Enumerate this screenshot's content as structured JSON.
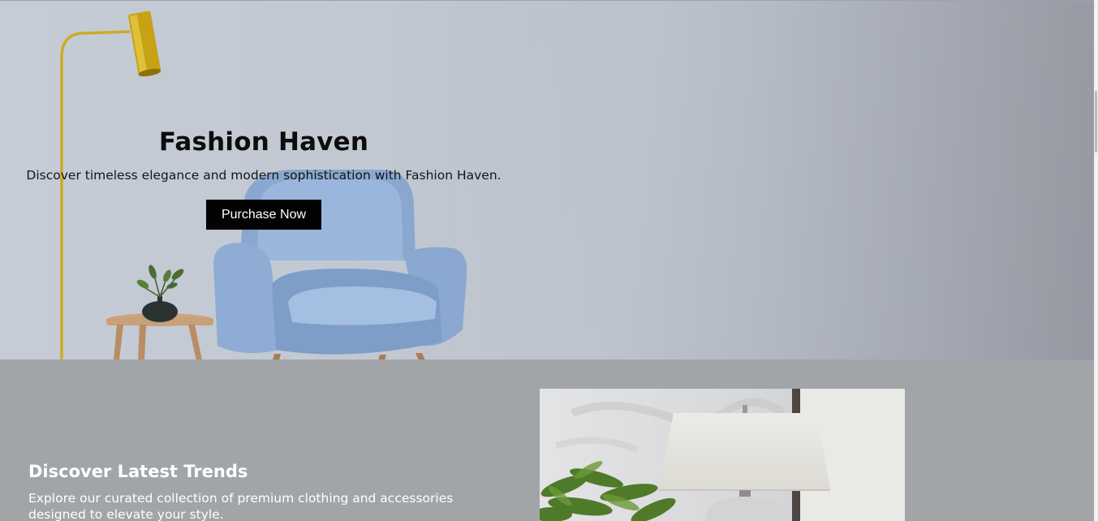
{
  "hero": {
    "title": "Fashion Haven",
    "subtitle": "Discover timeless elegance and modern sophistication with Fashion Haven.",
    "button_label": "Purchase Now"
  },
  "trends": {
    "title": "Discover Latest Trends",
    "description": "Explore our curated collection of premium clothing and accessories designed to elevate your style."
  },
  "colors": {
    "button_bg": "#030303",
    "button_text": "#ffffff",
    "trends_bg": "#a1a5a8",
    "chair": "#8fb0d8"
  }
}
